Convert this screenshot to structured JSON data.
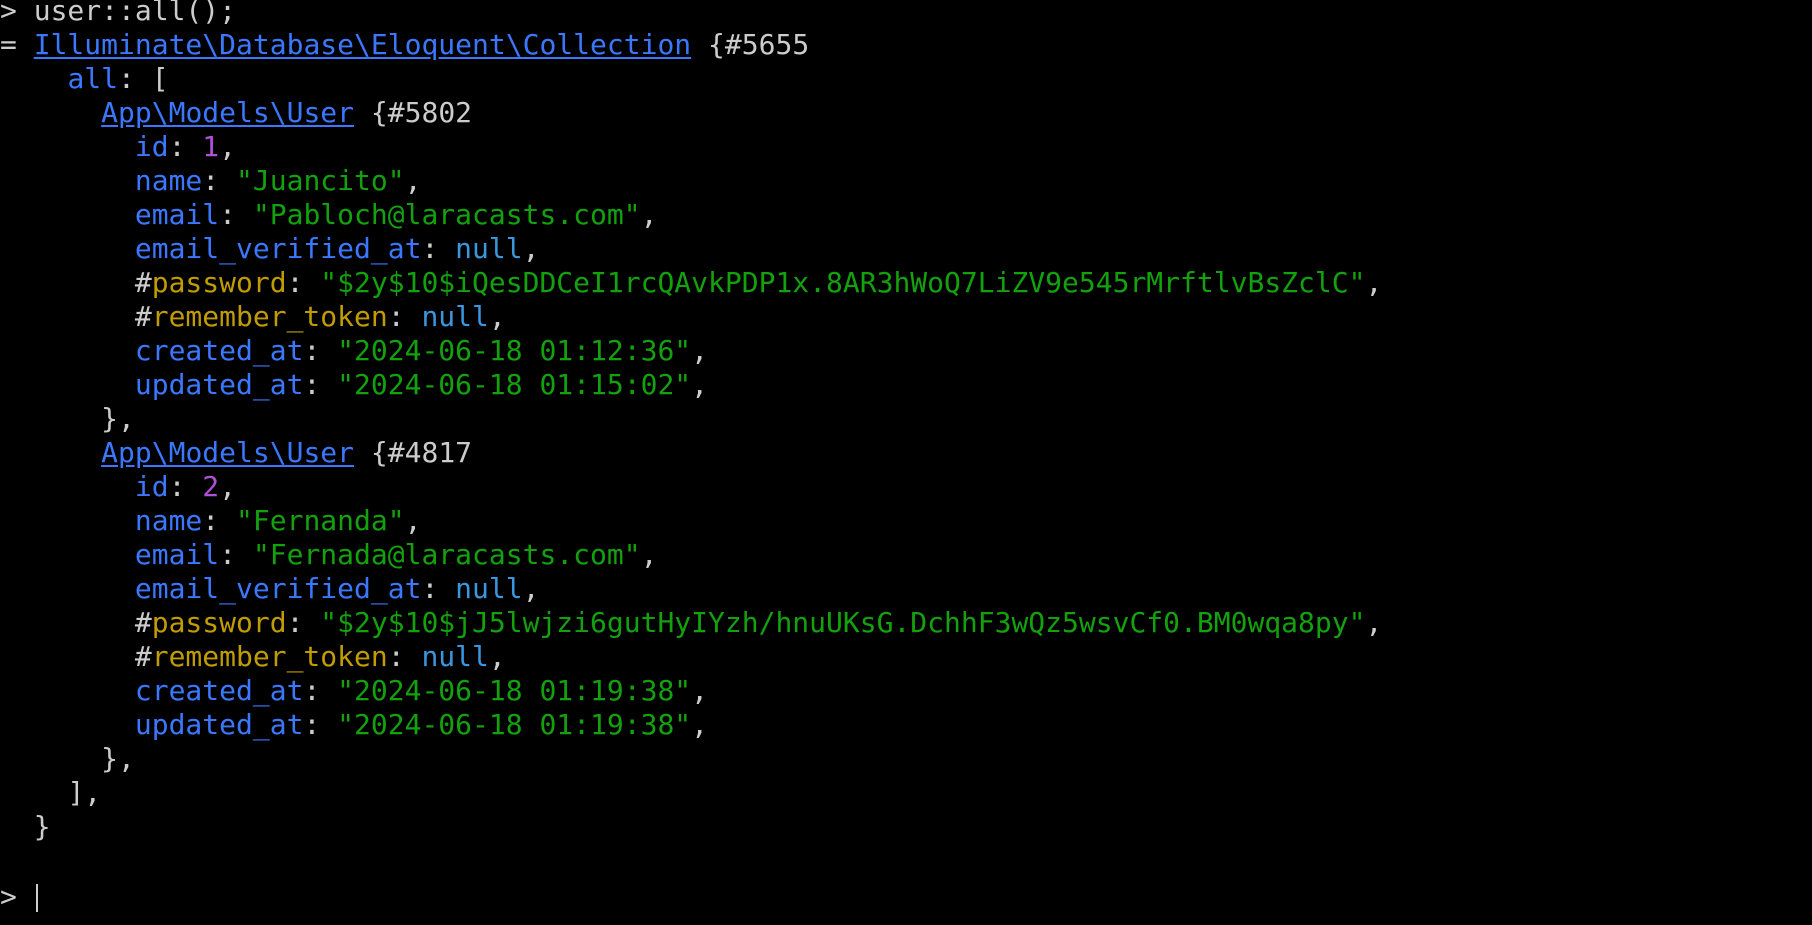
{
  "terminal": {
    "command_line": {
      "prompt": "> ",
      "command": "user::all();"
    },
    "result_marker": "= ",
    "collection": {
      "class": "Illuminate\\Database\\Eloquent\\Collection",
      "id": "{#5655",
      "all_key": "all",
      "open_bracket": ": [",
      "close_bracket": "],",
      "close_brace": "}"
    },
    "users": [
      {
        "class": "App\\Models\\User",
        "id_ref": "{#5802",
        "fields": {
          "id_key": "id",
          "id_val": "1",
          "name_key": "name",
          "name_val": "\"Juancito\"",
          "email_key": "email",
          "email_val": "\"Pabloch@laracasts.com\"",
          "ev_key": "email_verified_at",
          "ev_val": "null",
          "pw_hash": "#",
          "pw_key": "password",
          "pw_val": "\"$2y$10$iQesDDCeI1rcQAvkPDP1x.8AR3hWoQ7LiZV9e545rMrftlvBsZclC\"",
          "rt_hash": "#",
          "rt_key": "remember_token",
          "rt_val": "null",
          "ca_key": "created_at",
          "ca_val": "\"2024-06-18 01:12:36\"",
          "ua_key": "updated_at",
          "ua_val": "\"2024-06-18 01:15:02\""
        },
        "close": "},"
      },
      {
        "class": "App\\Models\\User",
        "id_ref": "{#4817",
        "fields": {
          "id_key": "id",
          "id_val": "2",
          "name_key": "name",
          "name_val": "\"Fernanda\"",
          "email_key": "email",
          "email_val": "\"Fernada@laracasts.com\"",
          "ev_key": "email_verified_at",
          "ev_val": "null",
          "pw_hash": "#",
          "pw_key": "password",
          "pw_val": "\"$2y$10$jJ5lwjzi6gutHyIYzh/hnuUKsG.DchhF3wQz5wsvCf0.BM0wqa8py\"",
          "rt_hash": "#",
          "rt_key": "remember_token",
          "rt_val": "null",
          "ca_key": "created_at",
          "ca_val": "\"2024-06-18 01:19:38\"",
          "ua_key": "updated_at",
          "ua_val": "\"2024-06-18 01:19:38\""
        },
        "close": "},"
      }
    ],
    "input_line": {
      "prompt": "> "
    },
    "colors": {
      "background": "#000000",
      "text": "#cccccc",
      "link": "#3b78ff",
      "key": "#3b78ff",
      "protected_key": "#c19c00",
      "integer": "#b14fd8",
      "string": "#13a10e",
      "null": "#3a96dd"
    }
  }
}
